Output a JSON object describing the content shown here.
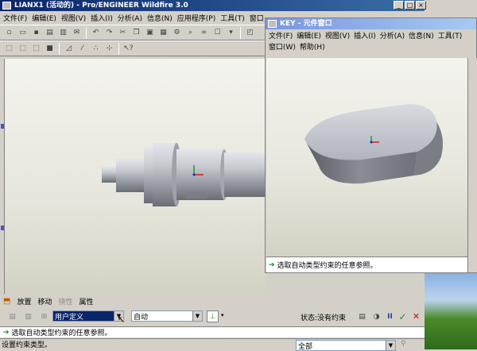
{
  "main_window": {
    "title": "LIANX1 (活动的) - Pro/ENGINEER Wildfire 3.0",
    "menu": [
      "文件(F)",
      "编辑(E)",
      "视图(V)",
      "插入(I)",
      "分析(A)",
      "信息(N)",
      "应用程序(P)",
      "工具(T)",
      "窗口"
    ],
    "window_buttons": [
      "_",
      "□",
      "×"
    ]
  },
  "key_window": {
    "title": "KEY - 元件窗口",
    "menu_row1": [
      "文件(F)",
      "编辑(E)",
      "视图(V)",
      "插入(I)",
      "分析(A)",
      "信息(N)",
      "工具(T)"
    ],
    "menu_row2": [
      "窗口(W)",
      "帮助(H)"
    ],
    "message": "选取自动类型约束的任意参照。"
  },
  "dashboard": {
    "tabs": [
      "放置",
      "移动",
      "挠性",
      "属性"
    ],
    "constraint_combo": "用户定义",
    "type_combo": "自动",
    "status_label": "状态:没有约束"
  },
  "message_line": "选取自动类型约束的任意参照。",
  "status_line": "设置约束类型。",
  "filter_combo": "全部",
  "colors": {
    "titlebar_active": "#0a246a",
    "titlebar_inactive": "#7a96df",
    "model": "#b8bcc4"
  }
}
